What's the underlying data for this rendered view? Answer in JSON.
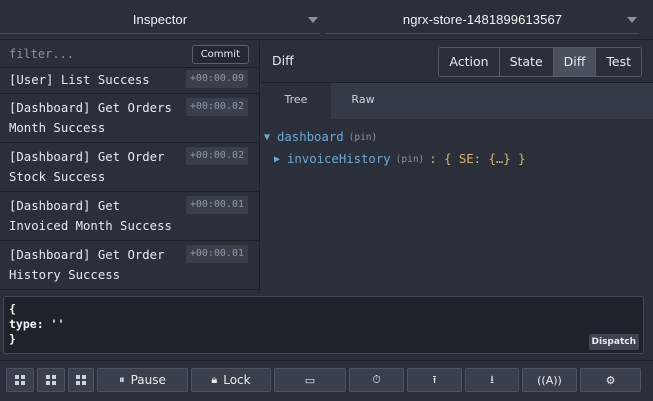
{
  "header": {
    "left_select": "Inspector",
    "right_select": "ngrx-store-1481899613567"
  },
  "actions_panel": {
    "filter_placeholder": "filter...",
    "commit_label": "Commit",
    "items": [
      {
        "name": "[User] List Success",
        "time": "+00:00.09"
      },
      {
        "name": "[Dashboard] Get Orders Month Success",
        "time": "+00:00.02"
      },
      {
        "name": "[Dashboard] Get Order Stock Success",
        "time": "+00:00.02"
      },
      {
        "name": "[Dashboard] Get Invoiced Month Success",
        "time": "+00:00.01"
      },
      {
        "name": "[Dashboard] Get Order History Success",
        "time": "+00:00.01"
      }
    ]
  },
  "inspector": {
    "title": "Diff",
    "tabs": [
      "Action",
      "State",
      "Diff",
      "Test"
    ],
    "active_tab": "Diff",
    "subtabs": [
      "Tree",
      "Raw"
    ],
    "active_subtab": "Tree",
    "tree": {
      "root_key": "dashboard",
      "root_pin": "(pin)",
      "child_key": "invoiceHistory",
      "child_pin": "(pin)",
      "child_value": ": { SE: {…} }"
    }
  },
  "dispatch": {
    "text": "{\ntype: ''\n}",
    "button_label": "Dispatch"
  },
  "toolbar": {
    "pause_label": "Pause",
    "lock_label": "Lock",
    "icons": [
      "grid-icon",
      "grid-icon",
      "grid-icon",
      "pause-icon",
      "lock-icon",
      "slider-icon",
      "timer-icon",
      "upload-icon",
      "download-icon",
      "remote-icon",
      "gear-icon"
    ]
  },
  "colors": {
    "background": "#2a2f3a",
    "tree_key": "#6fa7d7",
    "tree_value": "#d4b56a"
  }
}
